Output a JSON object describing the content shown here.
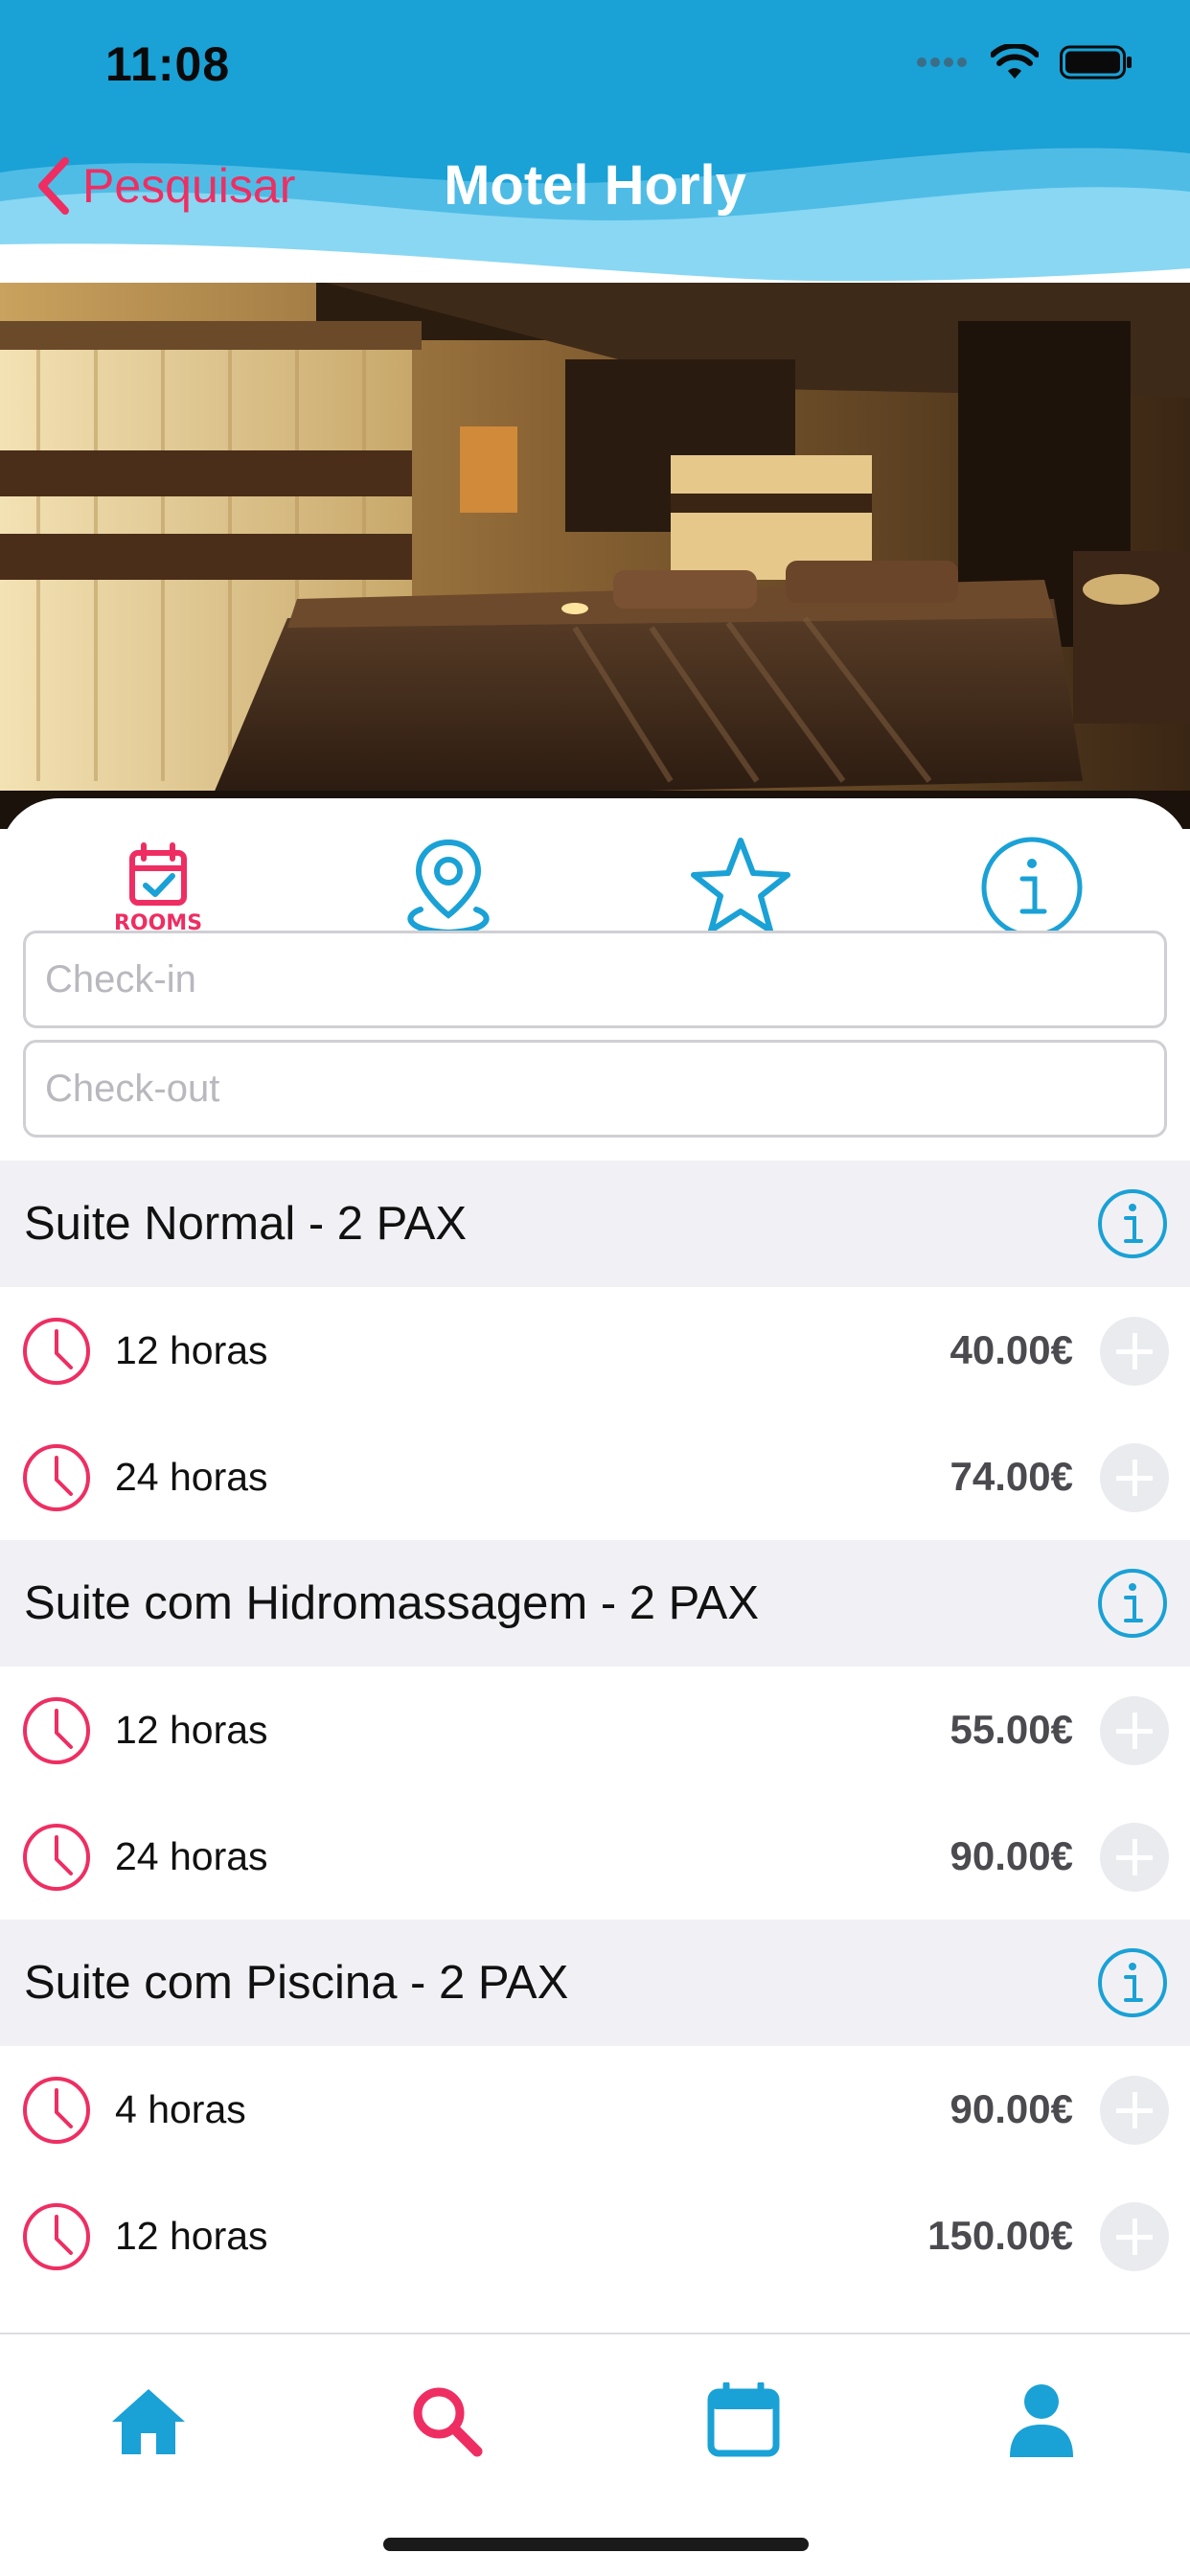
{
  "status_bar": {
    "time": "11:08"
  },
  "nav": {
    "back_label": "Pesquisar",
    "title": "Motel Horly"
  },
  "hero": {
    "image_description": "hotel-room-photo"
  },
  "tabs": [
    {
      "name": "rooms",
      "label": "ROOMS",
      "icon": "calendar-check-icon",
      "active": true
    },
    {
      "name": "location",
      "icon": "map-pin-icon",
      "active": false
    },
    {
      "name": "reviews",
      "icon": "star-icon",
      "active": false
    },
    {
      "name": "info",
      "icon": "info-icon",
      "active": false
    }
  ],
  "fields": {
    "checkin_placeholder": "Check-in",
    "checkout_placeholder": "Check-out"
  },
  "room_sections": [
    {
      "title": "Suite Normal - 2 PAX",
      "options": [
        {
          "duration": "12 horas",
          "price": "40.00€"
        },
        {
          "duration": "24 horas",
          "price": "74.00€"
        }
      ]
    },
    {
      "title": "Suite com Hidromassagem - 2 PAX",
      "options": [
        {
          "duration": "12 horas",
          "price": "55.00€"
        },
        {
          "duration": "24 horas",
          "price": "90.00€"
        }
      ]
    },
    {
      "title": "Suite com Piscina - 2 PAX",
      "options": [
        {
          "duration": "4 horas",
          "price": "90.00€"
        },
        {
          "duration": "12 horas",
          "price": "150.00€"
        }
      ]
    }
  ],
  "bottom_tabs": [
    {
      "name": "home",
      "icon": "home-icon"
    },
    {
      "name": "search",
      "icon": "search-icon",
      "active": true
    },
    {
      "name": "bookings",
      "icon": "calendar-icon"
    },
    {
      "name": "profile",
      "icon": "user-icon"
    }
  ],
  "colors": {
    "brand_blue": "#1aa1d6",
    "accent_pink": "#ee2e62",
    "price_gray": "#4a4a4f",
    "section_bg": "#f1f1f5"
  }
}
